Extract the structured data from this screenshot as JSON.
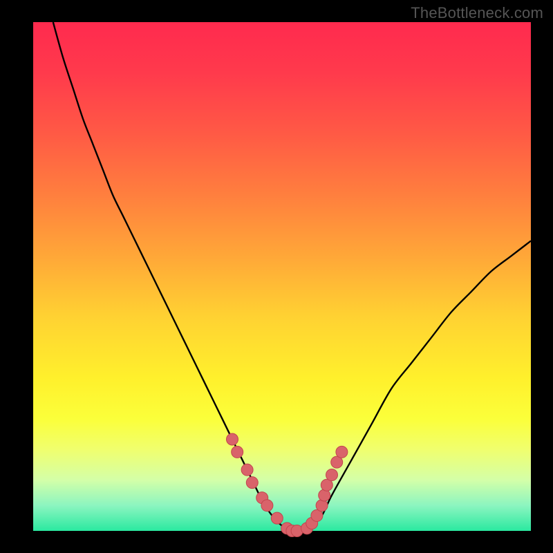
{
  "watermark": "TheBottleneck.com",
  "colors": {
    "curve_stroke": "#000000",
    "marker_fill": "#d9636a",
    "marker_stroke": "#c2454d",
    "background_black": "#000000"
  },
  "chart_data": {
    "type": "line",
    "title": "",
    "xlabel": "",
    "ylabel": "",
    "xlim": [
      0,
      100
    ],
    "ylim": [
      0,
      100
    ],
    "grid": false,
    "legend": false,
    "gradient_top_color": "#ff2a4e",
    "gradient_bottom_color": "#2ae9a0",
    "series": [
      {
        "name": "bottleneck-curve",
        "x": [
          4,
          6,
          8,
          10,
          12,
          14,
          16,
          18,
          20,
          22,
          24,
          26,
          28,
          30,
          32,
          34,
          36,
          38,
          40,
          42,
          44,
          46,
          48,
          50,
          52,
          54,
          56,
          58,
          60,
          64,
          68,
          72,
          76,
          80,
          84,
          88,
          92,
          96,
          100
        ],
        "y": [
          100,
          93,
          87,
          81,
          76,
          71,
          66,
          62,
          58,
          54,
          50,
          46,
          42,
          38,
          34,
          30,
          26,
          22,
          18,
          14,
          10,
          6,
          3,
          1,
          0,
          0,
          1,
          3,
          7,
          14,
          21,
          28,
          33,
          38,
          43,
          47,
          51,
          54,
          57
        ]
      }
    ],
    "markers": {
      "name": "highlight-points",
      "x": [
        40,
        41,
        43,
        44,
        46,
        47,
        49,
        51,
        52,
        53,
        55,
        56,
        57,
        58,
        58.5,
        59,
        60,
        61,
        62
      ],
      "y": [
        18,
        15.5,
        12,
        9.5,
        6.5,
        5,
        2.5,
        0.5,
        0,
        0,
        0.5,
        1.5,
        3,
        5,
        7,
        9,
        11,
        13.5,
        15.5
      ]
    }
  }
}
